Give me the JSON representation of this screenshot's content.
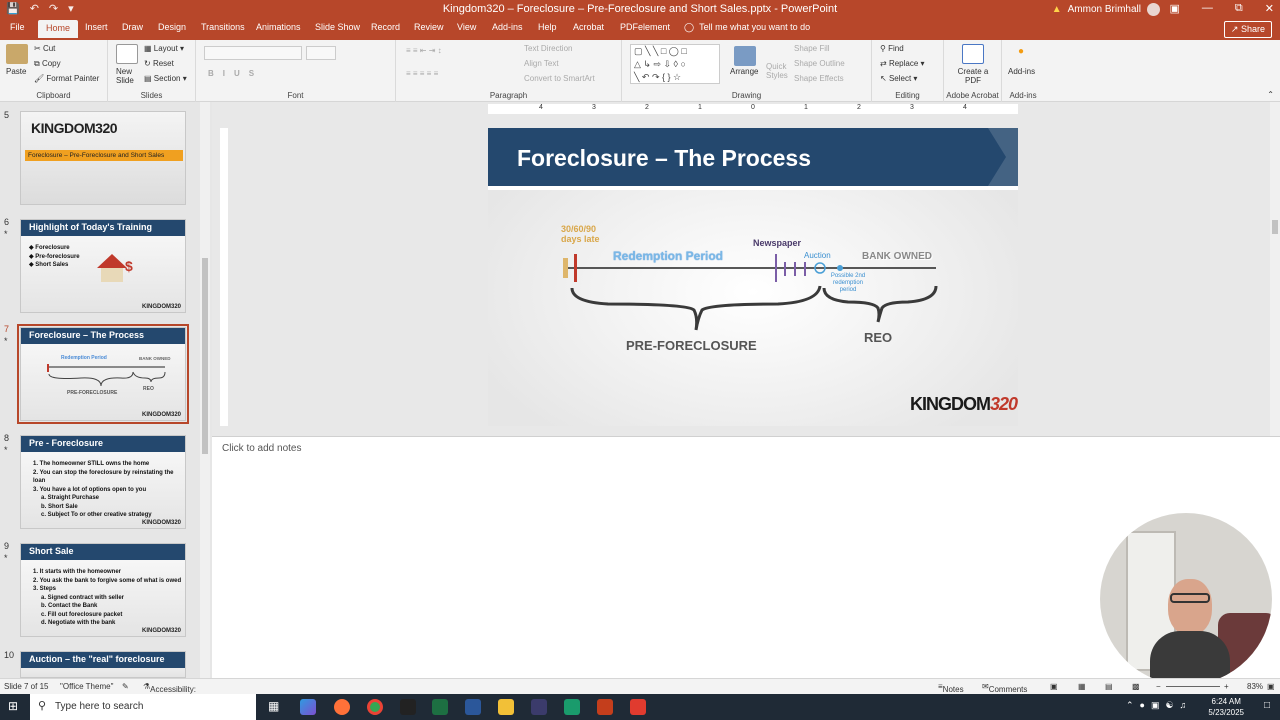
{
  "window": {
    "title": "Kingdom320 – Foreclosure – Pre-Foreclosure and Short Sales.pptx - PowerPoint",
    "user": "Ammon Brimhall"
  },
  "tabs": [
    "File",
    "Home",
    "Insert",
    "Draw",
    "Design",
    "Transitions",
    "Animations",
    "Slide Show",
    "Record",
    "Review",
    "View",
    "Add-ins",
    "Help",
    "Acrobat",
    "PDFelement"
  ],
  "active_tab": "Home",
  "tell_me": "Tell me what you want to do",
  "share_label": "Share",
  "ribbon": {
    "clipboard": {
      "paste": "Paste",
      "cut": "Cut",
      "copy": "Copy",
      "format_painter": "Format Painter",
      "label": "Clipboard"
    },
    "slides": {
      "new_slide": "New Slide",
      "layout": "Layout",
      "reset": "Reset",
      "section": "Section",
      "label": "Slides"
    },
    "font": {
      "label": "Font"
    },
    "paragraph": {
      "text_direction": "Text Direction",
      "align_text": "Align Text",
      "convert": "Convert to SmartArt",
      "label": "Paragraph"
    },
    "drawing": {
      "arrange": "Arrange",
      "quick_styles": "Quick Styles",
      "shape_fill": "Shape Fill",
      "shape_outline": "Shape Outline",
      "shape_effects": "Shape Effects",
      "label": "Drawing"
    },
    "editing": {
      "find": "Find",
      "replace": "Replace",
      "select": "Select",
      "label": "Editing"
    },
    "acrobat": {
      "create_pdf": "Create a PDF",
      "label": "Adobe Acrobat"
    },
    "addins": {
      "addins": "Add-ins",
      "label": "Add-ins"
    }
  },
  "thumbnails": [
    {
      "num": "5",
      "title": "KINGDOM320",
      "subtitle": "Foreclosure – Pre-Foreclosure and Short Sales"
    },
    {
      "num": "6",
      "title": "Highlight of Today's Training",
      "lines": [
        "Foreclosure",
        "Pre-foreclosure",
        "Short Sales"
      ]
    },
    {
      "num": "7",
      "title": "Foreclosure – The Process"
    },
    {
      "num": "8",
      "title": "Pre - Foreclosure",
      "lines": [
        "1.  The homeowner STILL owns the home",
        "2.  You can stop the foreclosure by reinstating the loan",
        "3.  You have a lot of options open to you",
        "a. Straight Purchase",
        "b. Short Sale",
        "c. Subject To or other creative strategy"
      ]
    },
    {
      "num": "9",
      "title": "Short Sale",
      "lines": [
        "1.  It starts with the homeowner",
        "2.  You ask the bank to forgive some of what is owed",
        "3.  Steps",
        "a. Signed contract with seller",
        "b. Contact the Bank",
        "c. Fill out foreclosure packet",
        "d. Negotiate with the bank"
      ]
    },
    {
      "num": "10",
      "title": "Auction – the \"real\" foreclosure"
    }
  ],
  "thumb_logo": "KINGDOM320",
  "ruler_h": [
    "4",
    "3",
    "2",
    "1",
    "0",
    "1",
    "2",
    "3",
    "4"
  ],
  "slide": {
    "title": "Foreclosure – The Process",
    "days_late": "30/60/90",
    "days_late_2": "days late",
    "redemption": "Redemption Period",
    "newspaper": "Newspaper",
    "auction": "Auction",
    "bank_owned": "BANK OWNED",
    "possible": "Possible 2nd redemption period",
    "pre_foreclosure": "PRE-FORECLOSURE",
    "reo": "REO",
    "logo": "KINGDOM",
    "logo_num": "320"
  },
  "notes_placeholder": "Click to add notes",
  "status": {
    "slide_of": "Slide 7 of 15",
    "theme": "\"Office Theme\"",
    "accessibility": "Accessibility: Investigate",
    "notes": "Notes",
    "comments": "Comments",
    "zoom": "83%"
  },
  "taskbar": {
    "search": "Type here to search",
    "time": "6:24 AM",
    "date": "5/23/2025"
  },
  "colors": {
    "accent": "#b7472a",
    "slide_blue": "#24486e",
    "brand_red": "#c0392b"
  }
}
